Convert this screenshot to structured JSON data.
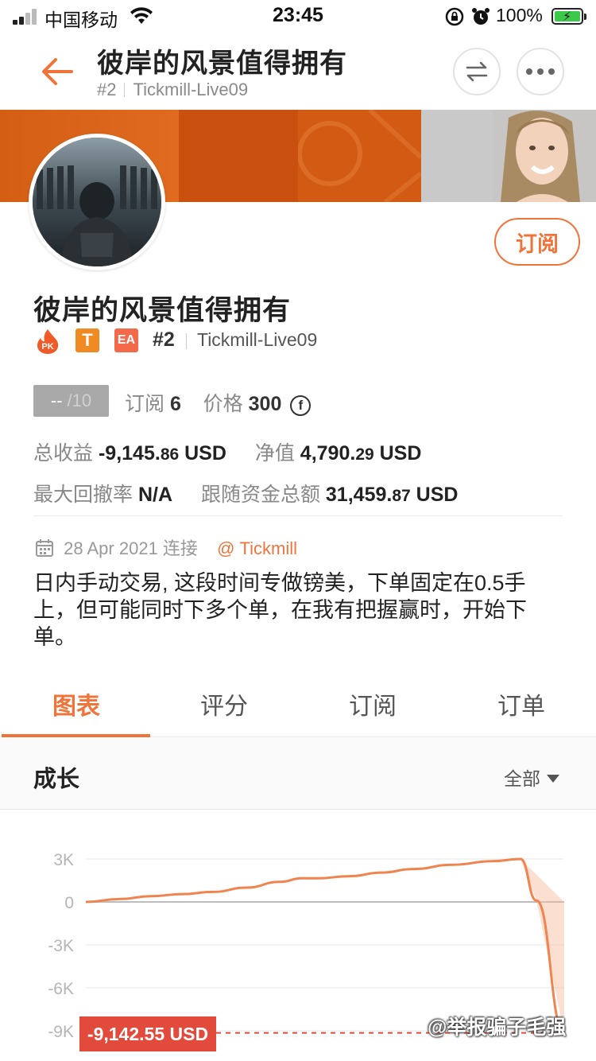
{
  "status_bar": {
    "carrier": "中国移动",
    "time": "23:45",
    "battery": "100%"
  },
  "header": {
    "title": "彼岸的风景值得拥有",
    "rank": "#2",
    "account": "Tickmill-Live09",
    "back_icon": "back-arrow-icon",
    "swap_icon": "swap-icon",
    "more_icon": "more-icon"
  },
  "profile": {
    "name": "彼岸的风景值得拥有",
    "subscribe_label": "订阅",
    "badges": [
      "PK",
      "T",
      "EA"
    ],
    "rank": "#2",
    "account": "Tickmill-Live09",
    "score": "--",
    "score_max": "/10",
    "subscriptions_label": "订阅",
    "subscriptions_value": "6",
    "price_label": "价格",
    "price_value": "300",
    "price_currency_icon": "ⓕ"
  },
  "stats": {
    "total_profit_label": "总收益",
    "total_profit_value": "-9,145.",
    "total_profit_decimals": "86",
    "total_profit_unit": "USD",
    "equity_label": "净值",
    "equity_value": "4,790.",
    "equity_decimals": "29",
    "equity_unit": "USD",
    "drawdown_label": "最大回撤率",
    "drawdown_value": "N/A",
    "follow_funds_label": "跟随资金总额",
    "follow_funds_value": "31,459.",
    "follow_funds_decimals": "87",
    "follow_funds_unit": "USD"
  },
  "connection": {
    "date": "28 Apr 2021",
    "action": "连接",
    "broker": "@ Tickmill"
  },
  "description": "日内手动交易, 这段时间专做镑美，下单固定在0.5手上，但可能同时下多个单，在我有把握赢时，开始下单。",
  "tabs": [
    {
      "label": "图表",
      "active": true
    },
    {
      "label": "评分",
      "active": false
    },
    {
      "label": "订阅",
      "active": false
    },
    {
      "label": "订单",
      "active": false
    }
  ],
  "growth": {
    "title": "成长",
    "filter": "全部"
  },
  "chart_data": {
    "type": "line",
    "y_ticks": [
      "3K",
      "0",
      "-3K",
      "-6K",
      "-9K"
    ],
    "ylim": [
      -9000,
      3000
    ],
    "series": [
      {
        "values": [
          0,
          200,
          400,
          550,
          700,
          1000,
          1400,
          1650,
          1650,
          1800,
          2050,
          2300,
          2600,
          2850,
          3000,
          100,
          -9142.55
        ]
      }
    ],
    "current_value_label": "-9,142.55 USD",
    "line_color": "#f0844f"
  },
  "watermark": "@举报骗子毛强"
}
